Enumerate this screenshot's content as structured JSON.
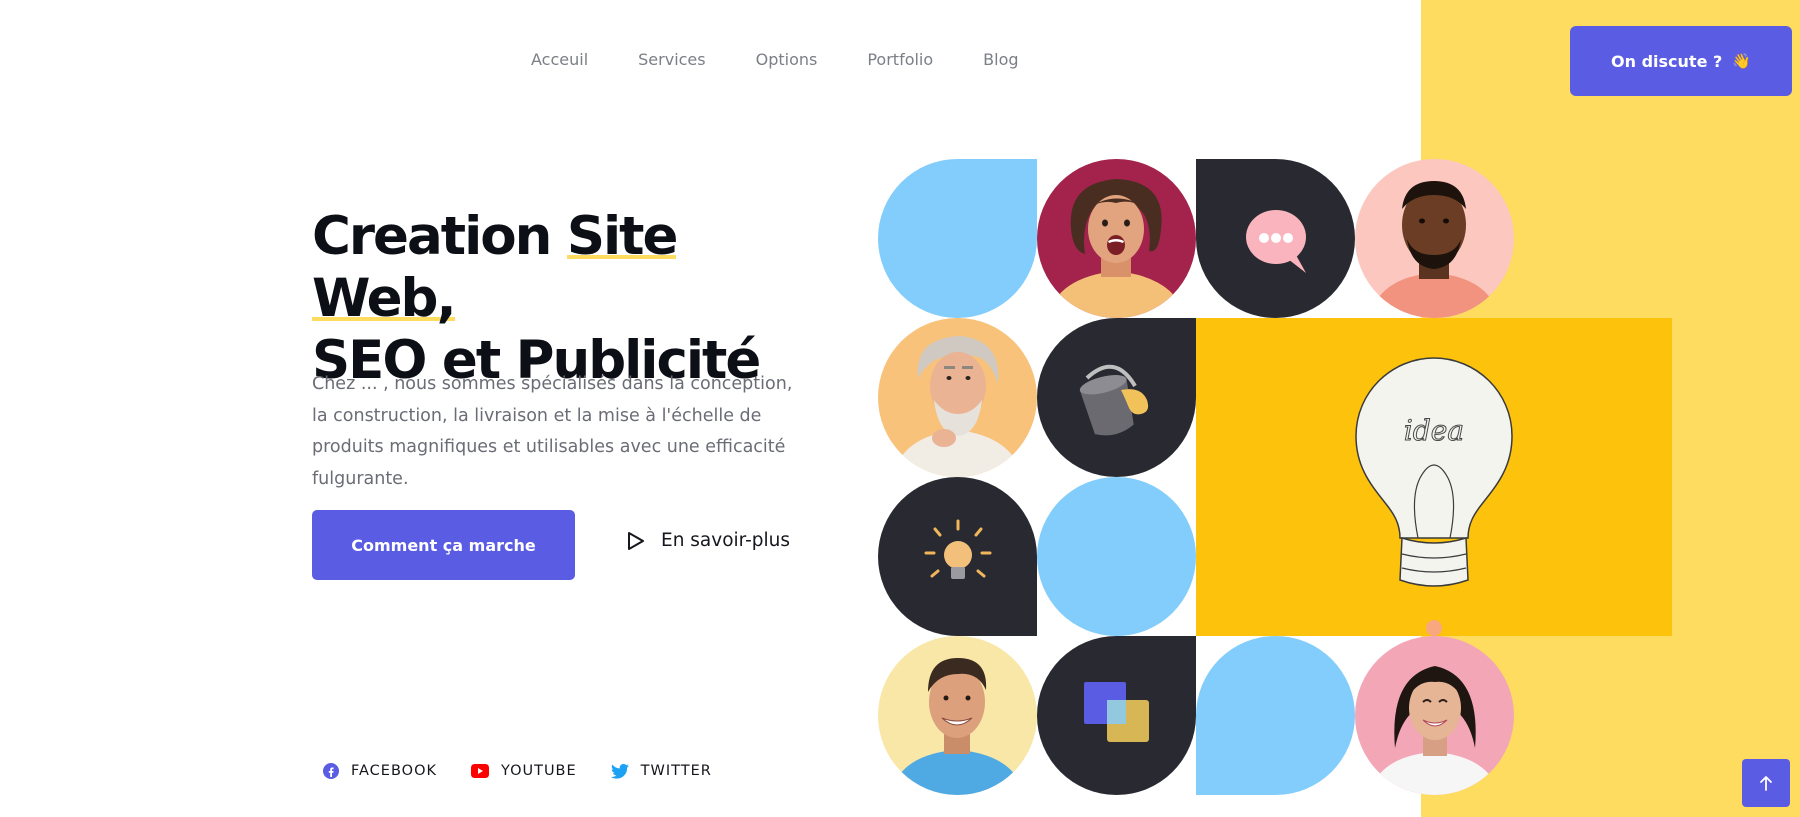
{
  "nav": {
    "items": [
      {
        "label": "Acceuil"
      },
      {
        "label": "Services"
      },
      {
        "label": "Options"
      },
      {
        "label": "Portfolio"
      },
      {
        "label": "Blog"
      }
    ],
    "cta_label": "On discute ?",
    "cta_emoji": "👋"
  },
  "hero": {
    "title_pre": "Creation ",
    "title_highlight": "Site Web,",
    "title_line2": "SEO et Publicité",
    "description": "Chez ... , nous sommes spécialisés dans la conception, la construction, la livraison et la mise à l'échelle de produits magnifiques et utilisables avec une efficacité fulgurante.",
    "primary_button": "Comment ça marche",
    "secondary_link": "En savoir-plus"
  },
  "social": [
    {
      "label": "FACEBOOK",
      "icon": "facebook-icon",
      "color": "#5a5ce4"
    },
    {
      "label": "YOUTUBE",
      "icon": "youtube-icon",
      "color": "#ff0000"
    },
    {
      "label": "TWITTER",
      "icon": "twitter-icon",
      "color": "#1da1f2"
    }
  ],
  "idea_text": "idea",
  "colors": {
    "accent": "#5a5ce4",
    "yellow": "#fedc5f",
    "sky": "#82cdfb",
    "dark": "#292a31"
  }
}
